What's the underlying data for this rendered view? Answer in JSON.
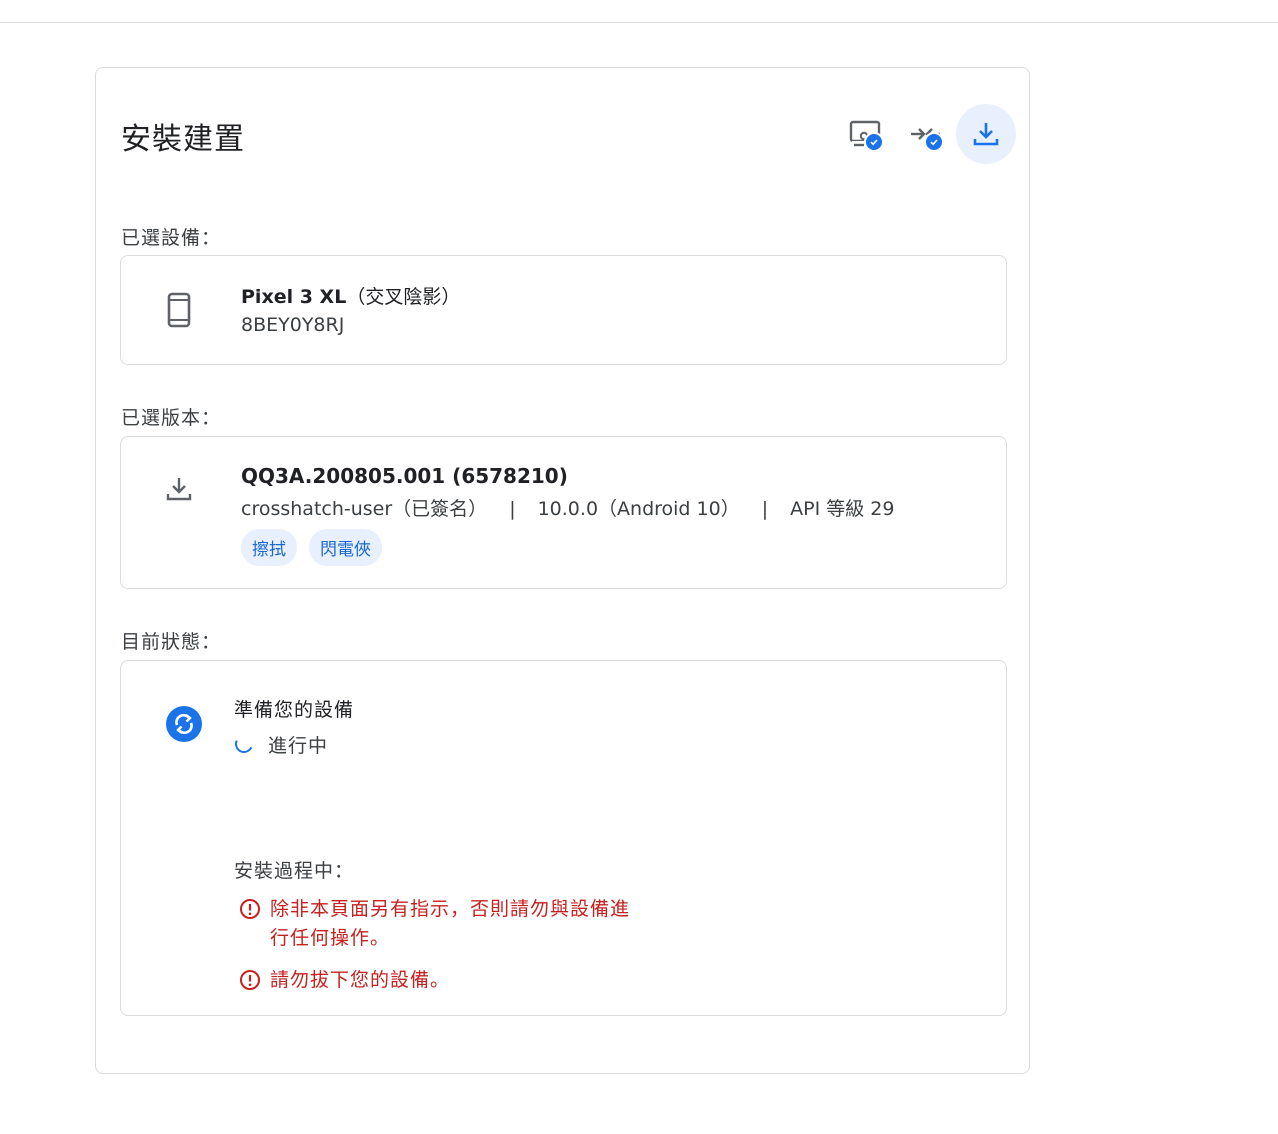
{
  "page": {
    "title": "安裝建置",
    "steps": [
      {
        "icon": "device-settings-check-icon",
        "state": "complete"
      },
      {
        "icon": "connect-check-icon",
        "state": "complete"
      },
      {
        "icon": "download-icon",
        "state": "active"
      }
    ]
  },
  "device_section": {
    "label": "已選設備：",
    "icon": "phone-icon",
    "device_name": "Pixel 3 XL",
    "device_codename": "（交叉陰影）",
    "serial": "8BEY0Y8RJ"
  },
  "build_section": {
    "label": "已選版本：",
    "icon": "download-icon",
    "build_id": "QQ3A.200805.001 (6578210)",
    "target": "crosshatch-user（已簽名）",
    "separator": "|",
    "version": "10.0.0（Android 10）",
    "api": "API 等級 29",
    "chips": [
      "擦拭",
      "閃電俠"
    ]
  },
  "status_section": {
    "label": "目前狀態：",
    "icon": "sync-icon",
    "title": "準備您的設備",
    "progress": "進行中",
    "during_label": "安裝過程中：",
    "warnings": [
      {
        "icon": "error-icon",
        "text": "除非本頁面另有指示，否則請勿與設備進行任何操作。"
      },
      {
        "icon": "error-icon",
        "text": "請勿拔下您的設備。"
      }
    ]
  },
  "colors": {
    "accent": "#1a73e8",
    "chip_bg": "#e8f0fe",
    "warning": "#c5221f",
    "border": "#dadce0"
  }
}
